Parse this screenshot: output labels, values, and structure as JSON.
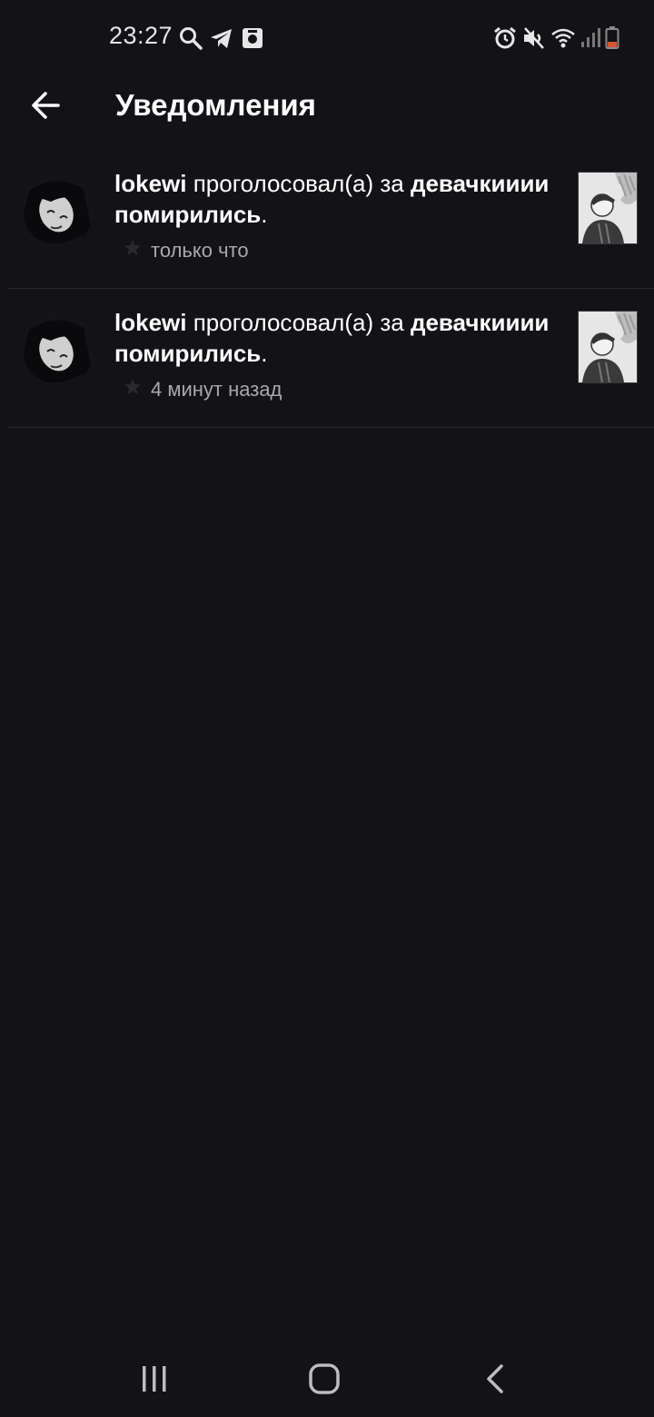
{
  "status_bar": {
    "time": "23:27",
    "left_icons": [
      "search-icon",
      "telegram-icon",
      "app-notification-icon"
    ],
    "right_icons": [
      "alarm-icon",
      "mute-icon",
      "wifi-icon",
      "signal-icon",
      "battery-icon"
    ],
    "battery_color": "#d9552f"
  },
  "app_bar": {
    "title": "Уведомления",
    "back_icon": "arrow-left-icon"
  },
  "notifications": [
    {
      "user": "lokewi",
      "action": " проголосовал(а) за ",
      "target": "девачкииии помирились",
      "end": ".",
      "time": "только что"
    },
    {
      "user": "lokewi",
      "action": " проголосовал(а) за ",
      "target": "девачкииии помирились",
      "end": ".",
      "time": "4 минут назад"
    }
  ],
  "nav_bar": {
    "icons": [
      "recent-apps-icon",
      "home-icon",
      "back-icon"
    ]
  },
  "colors": {
    "background": "#131216",
    "text_primary": "#ffffff",
    "text_secondary": "#a8a8ad",
    "divider": "#2b2a30"
  }
}
